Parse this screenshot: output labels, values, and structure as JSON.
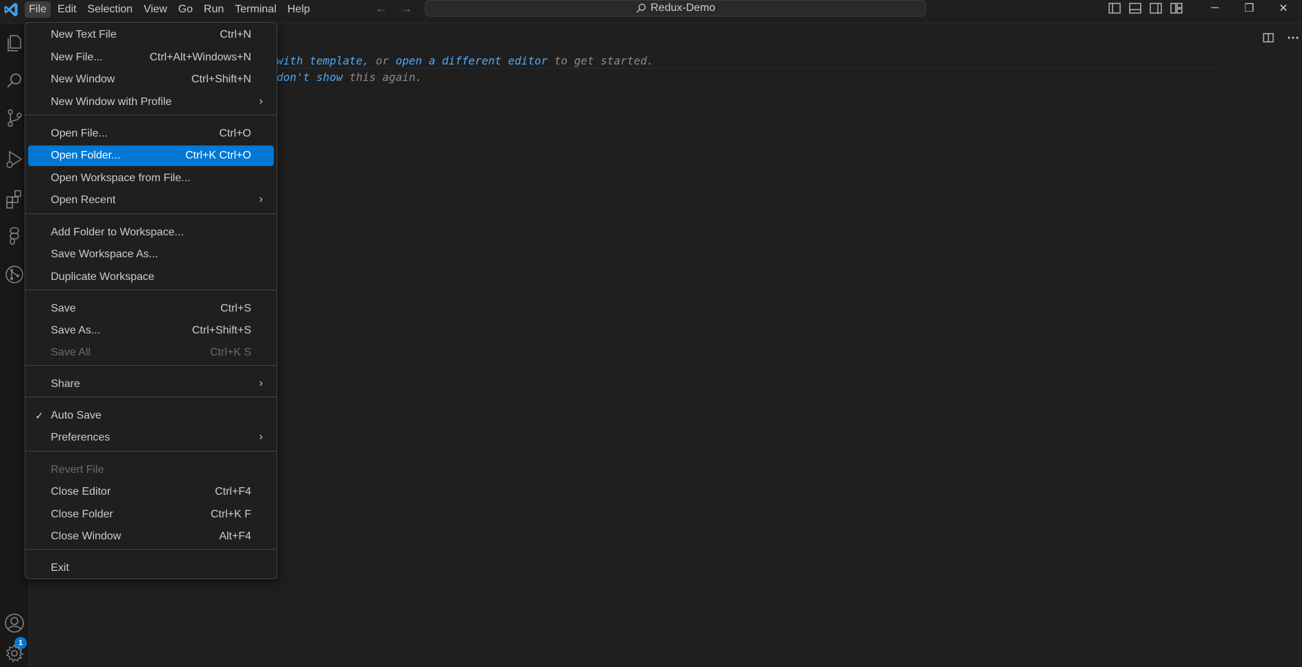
{
  "menubar": [
    "File",
    "Edit",
    "Selection",
    "View",
    "Go",
    "Run",
    "Terminal",
    "Help"
  ],
  "command_center": {
    "label": "Redux-Demo",
    "icon": "search-icon"
  },
  "nav": {
    "back_icon": "arrow-left-icon",
    "forward_icon": "arrow-right-icon"
  },
  "window_controls": {
    "minimize": "─",
    "restore": "❐",
    "close": "✕"
  },
  "editor": {
    "hint1": {
      "link1": "with template",
      "t1": ", or ",
      "link2": "open a different editor",
      "t2": " to get started."
    },
    "hint2": {
      "link1": "don't show",
      "t1": " this again."
    }
  },
  "activity": {
    "accounts_badge": "1"
  },
  "file_menu": {
    "groups": [
      [
        {
          "label": "New Text File",
          "key": "Ctrl+N"
        },
        {
          "label": "New File...",
          "key": "Ctrl+Alt+Windows+N"
        },
        {
          "label": "New Window",
          "key": "Ctrl+Shift+N"
        },
        {
          "label": "New Window with Profile",
          "submenu": true
        }
      ],
      [
        {
          "label": "Open File...",
          "key": "Ctrl+O"
        },
        {
          "label": "Open Folder...",
          "key": "Ctrl+K Ctrl+O",
          "highlighted": true
        },
        {
          "label": "Open Workspace from File..."
        },
        {
          "label": "Open Recent",
          "submenu": true
        }
      ],
      [
        {
          "label": "Add Folder to Workspace..."
        },
        {
          "label": "Save Workspace As..."
        },
        {
          "label": "Duplicate Workspace"
        }
      ],
      [
        {
          "label": "Save",
          "key": "Ctrl+S"
        },
        {
          "label": "Save As...",
          "key": "Ctrl+Shift+S"
        },
        {
          "label": "Save All",
          "key": "Ctrl+K S",
          "disabled": true
        }
      ],
      [
        {
          "label": "Share",
          "submenu": true
        }
      ],
      [
        {
          "label": "Auto Save",
          "checked": true
        },
        {
          "label": "Preferences",
          "submenu": true
        }
      ],
      [
        {
          "label": "Revert File",
          "disabled": true
        },
        {
          "label": "Close Editor",
          "key": "Ctrl+F4"
        },
        {
          "label": "Close Folder",
          "key": "Ctrl+K F"
        },
        {
          "label": "Close Window",
          "key": "Alt+F4"
        }
      ],
      [
        {
          "label": "Exit"
        }
      ]
    ]
  },
  "colors": {
    "accent": "#0078d4",
    "link": "#4daafc",
    "background": "#1f1f1f"
  }
}
